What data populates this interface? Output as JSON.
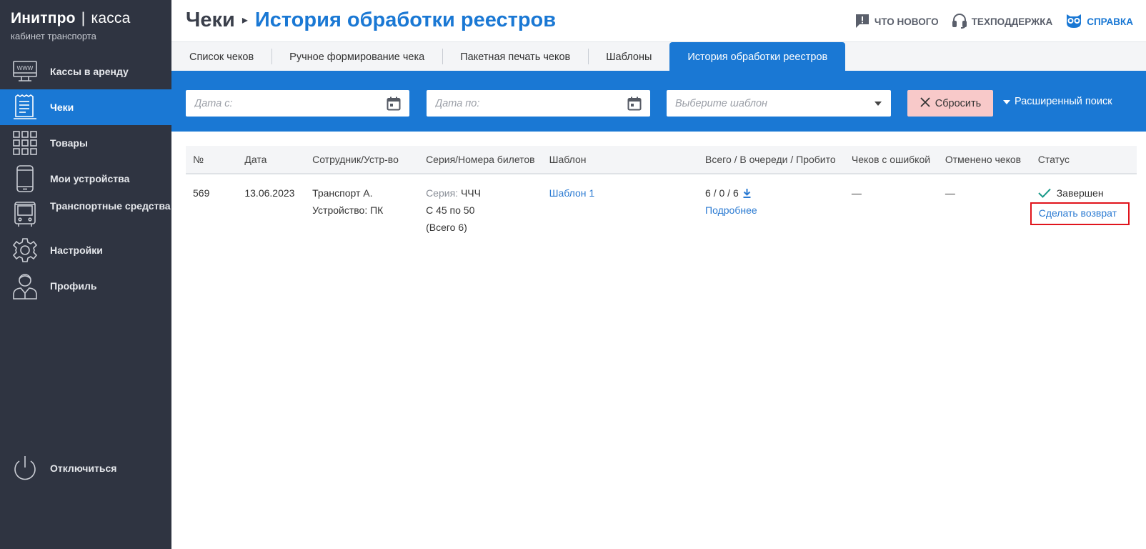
{
  "brand": {
    "name": "Инитпро",
    "separator": "|",
    "product": "касса",
    "subtitle": "кабинет транспорта"
  },
  "sidebar": {
    "items": [
      {
        "label": "Кассы в аренду",
        "icon": "www-monitor-icon",
        "active": false
      },
      {
        "label": "Чеки",
        "icon": "receipt-icon",
        "active": true
      },
      {
        "label": "Товары",
        "icon": "grid-icon",
        "active": false
      },
      {
        "label": "Мои устройства",
        "icon": "smartphone-icon",
        "active": false
      },
      {
        "label": "Транспортные средства",
        "icon": "bus-icon",
        "active": false
      },
      {
        "label": "Настройки",
        "icon": "gear-icon",
        "active": false
      },
      {
        "label": "Профиль",
        "icon": "user-icon",
        "active": false
      }
    ],
    "logout": {
      "label": "Отключиться",
      "icon": "power-icon"
    }
  },
  "header": {
    "breadcrumb_parent": "Чеки",
    "breadcrumb_sep": "▸",
    "title": "История обработки реестров",
    "links": {
      "whats_new": "ЧТО НОВОГО",
      "support": "ТЕХПОДДЕРЖКА",
      "help": "СПРАВКА"
    }
  },
  "tabs": [
    {
      "label": "Список чеков",
      "active": false
    },
    {
      "label": "Ручное формирование чека",
      "active": false
    },
    {
      "label": "Пакетная печать чеков",
      "active": false
    },
    {
      "label": "Шаблоны",
      "active": false
    },
    {
      "label": "История обработки реестров",
      "active": true
    }
  ],
  "filters": {
    "date_from_placeholder": "Дата с:",
    "date_to_placeholder": "Дата по:",
    "template_placeholder": "Выберите шаблон",
    "reset_label": "Сбросить",
    "advanced_search_label": "Расширенный поиск"
  },
  "table": {
    "columns": [
      "№",
      "Дата",
      "Сотрудник/Устр-во",
      "Серия/Номера билетов",
      "Шаблон",
      "Всего / В очереди / Пробито",
      "Чеков с ошибкой",
      "Отменено чеков",
      "Статус"
    ],
    "rows": [
      {
        "number": "569",
        "date": "13.06.2023",
        "employee": "Транспорт А.",
        "device": "Устройство: ПК",
        "series_label": "Серия:",
        "series_value": "ЧЧЧ",
        "range": "С 45 по 50",
        "total_tickets": "(Всего 6)",
        "template": "Шаблон 1",
        "counts": "6 / 0 / 6",
        "details_link": "Подробнее",
        "errors": "—",
        "cancelled": "—",
        "status": "Завершен",
        "refund_link": "Сделать возврат"
      }
    ]
  },
  "colors": {
    "sidebar_bg": "#2f3441",
    "accent": "#1a78d4",
    "reset_bg": "#f8c9c9",
    "highlight_border": "#e0141c",
    "status_check": "#1a9a8a"
  }
}
